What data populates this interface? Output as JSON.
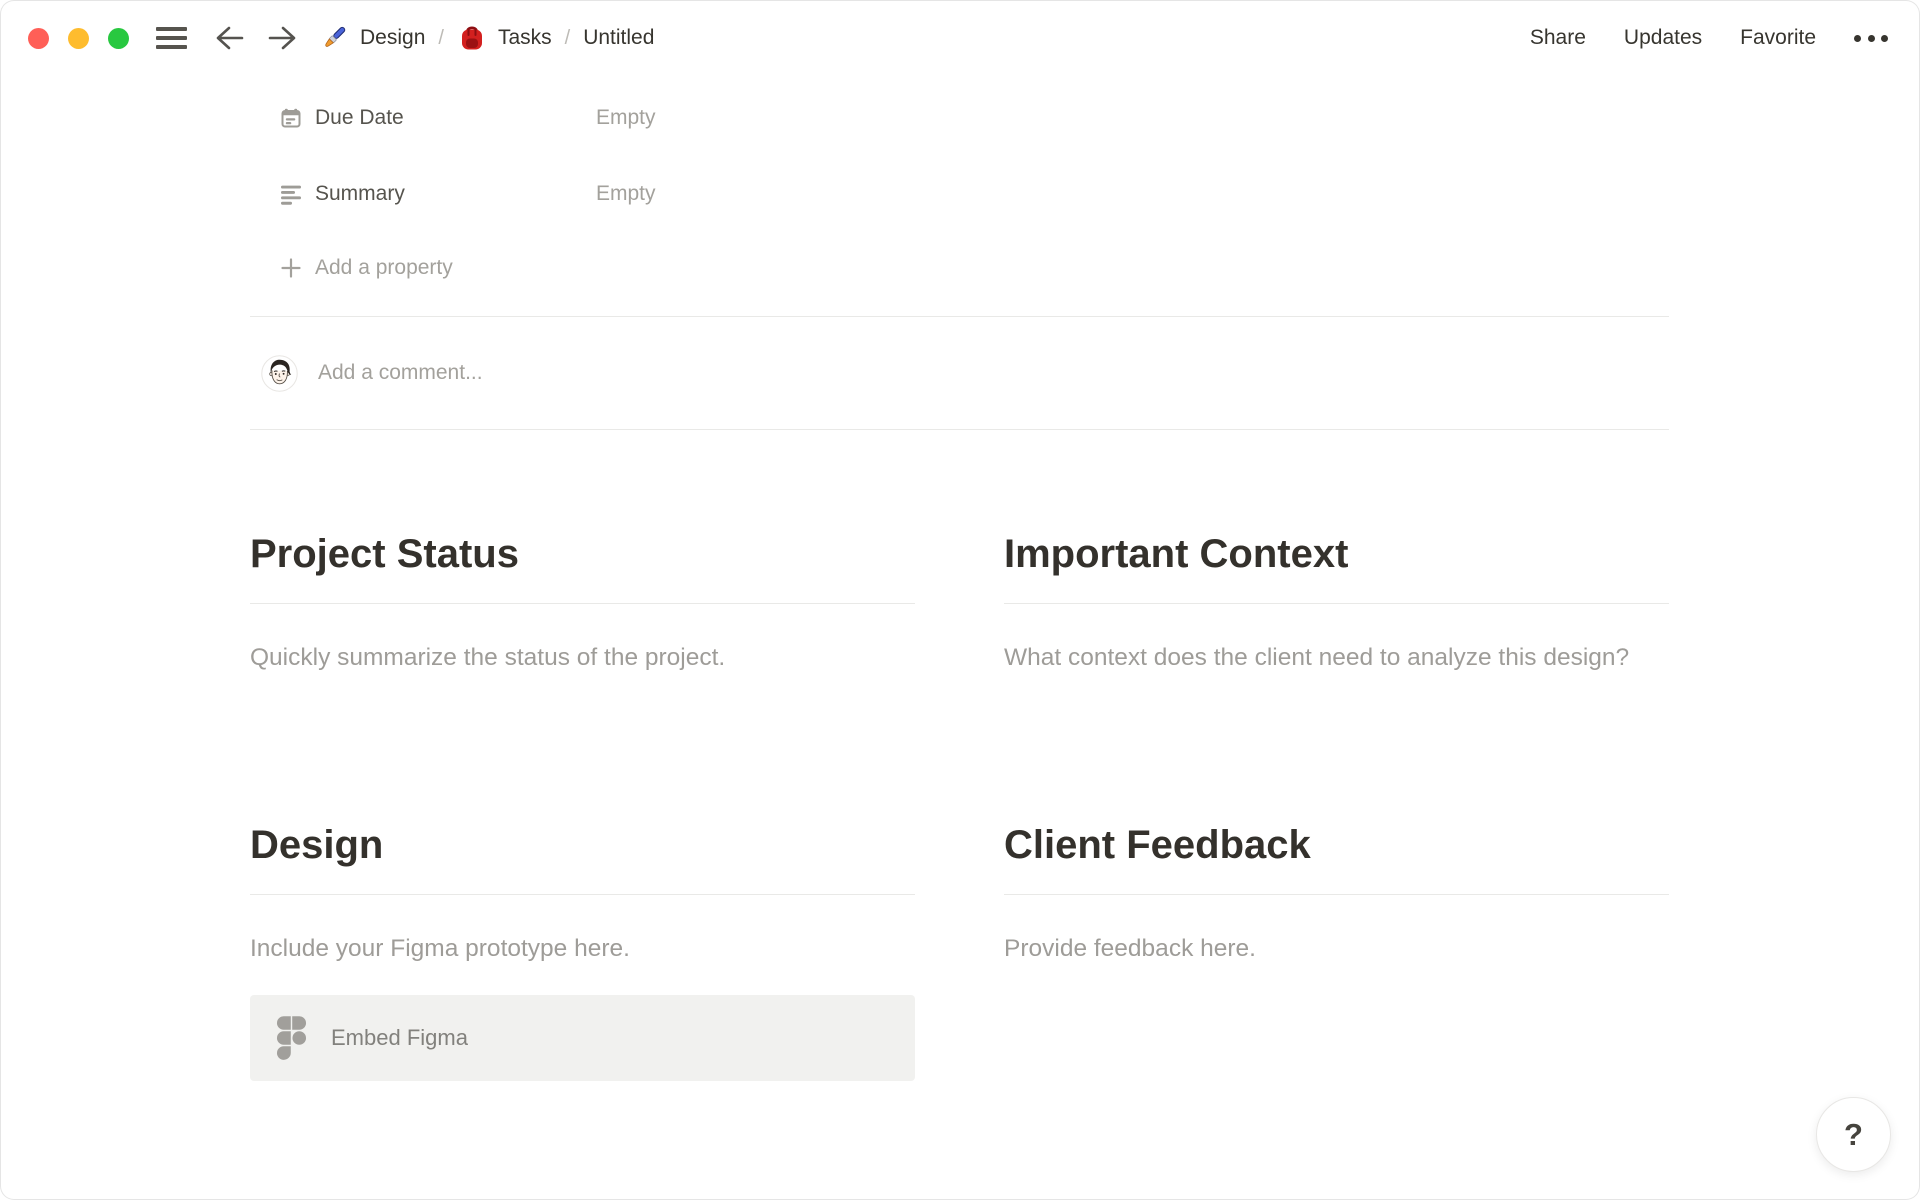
{
  "topbar": {
    "breadcrumb": {
      "separator": "/",
      "item1": {
        "icon": "paintbrush-icon",
        "label": "Design"
      },
      "item2": {
        "icon": "backpack-icon",
        "label": "Tasks"
      },
      "item3": {
        "label": "Untitled"
      }
    },
    "actions": {
      "share": "Share",
      "updates": "Updates",
      "favorite": "Favorite",
      "more_icon": "ellipsis-icon"
    }
  },
  "properties": {
    "rows": [
      {
        "icon": "calendar-icon",
        "label": "Due Date",
        "value": "Empty"
      },
      {
        "icon": "text-align-left-icon",
        "label": "Summary",
        "value": "Empty"
      }
    ],
    "add_property_label": "Add a property"
  },
  "comment": {
    "placeholder": "Add a comment..."
  },
  "sections": [
    {
      "title": "Project Status",
      "body": "Quickly summarize the status of the project."
    },
    {
      "title": "Important Context",
      "body": "What context does the client need to analyze this design?"
    },
    {
      "title": "Design",
      "body": "Include your Figma prototype here.",
      "embed_label": "Embed Figma",
      "embed_icon": "figma-icon"
    },
    {
      "title": "Client Feedback",
      "body": "Provide feedback here."
    }
  ],
  "help_button": {
    "label": "?"
  },
  "colors": {
    "text": "#37352f",
    "muted_text": "#9e9c98",
    "label_text": "#56544e",
    "divider": "#e9e9e7",
    "embed_bg": "#f1f1ef",
    "traffic_red": "#ff5f57",
    "traffic_yellow": "#febc2e",
    "traffic_green": "#28c840"
  }
}
